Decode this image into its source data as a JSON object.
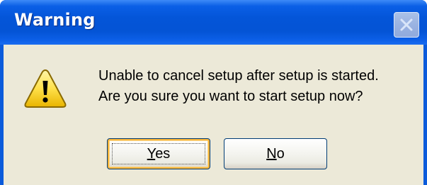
{
  "dialog": {
    "title": "Warning",
    "message_lines": [
      "Unable to cancel setup after setup is started.",
      "Are you sure you want to start setup now?"
    ],
    "icon": "warning-icon",
    "close_icon": "close-icon"
  },
  "buttons": {
    "yes": {
      "mnemonic": "Y",
      "rest": "es"
    },
    "no": {
      "mnemonic": "N",
      "rest": "o"
    }
  },
  "colors": {
    "titlebar": "#0454d5",
    "body": "#ece9d8",
    "default_button_highlight": "#f8b43a"
  }
}
